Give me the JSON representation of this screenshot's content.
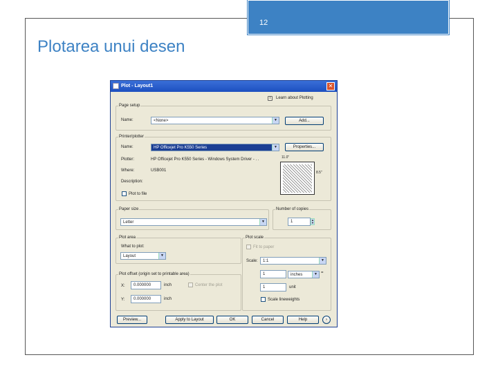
{
  "slide": {
    "number": "12",
    "title": "Plotarea unui desen"
  },
  "dialog": {
    "title": "Plot - Layout1",
    "learn_link": "Learn about Plotting",
    "page_setup": {
      "group": "Page setup",
      "name_label": "Name:",
      "name_value": "<None>",
      "add_button": "Add..."
    },
    "printer": {
      "group": "Printer/plotter",
      "name_label": "Name:",
      "name_value": "HP Officejet Pro K550 Series",
      "properties_button": "Properties...",
      "plotter_label": "Plotter:",
      "plotter_value": "HP Officejet Pro K550 Series - Windows System Driver - . .",
      "where_label": "Where:",
      "where_value": "USB001",
      "description_label": "Description:",
      "plot_to_file": "Plot to file",
      "paper_width": "11.0\"",
      "paper_height": "8.5\""
    },
    "paper_size": {
      "group": "Paper size",
      "value": "Letter"
    },
    "copies": {
      "group": "Number of copies",
      "value": "1"
    },
    "plot_area": {
      "group": "Plot area",
      "what_label": "What to plot:",
      "what_value": "Layout"
    },
    "plot_scale": {
      "group": "Plot scale",
      "fit_to_paper": "Fit to paper",
      "scale_label": "Scale:",
      "scale_value": "1:1",
      "value1": "1",
      "unit1": "inches",
      "value2": "1",
      "unit2": "unit",
      "scale_lineweights": "Scale lineweights",
      "equals": "="
    },
    "plot_offset": {
      "group": "Plot offset (origin set to printable area)",
      "x_label": "X:",
      "x_value": "0.000000",
      "x_unit": "inch",
      "y_label": "Y:",
      "y_value": "0.000000",
      "y_unit": "inch",
      "center_plot": "Center the plot"
    },
    "buttons": {
      "preview": "Preview...",
      "apply": "Apply to Layout",
      "ok": "OK",
      "cancel": "Cancel",
      "help": "Help",
      "expand": "›"
    }
  }
}
